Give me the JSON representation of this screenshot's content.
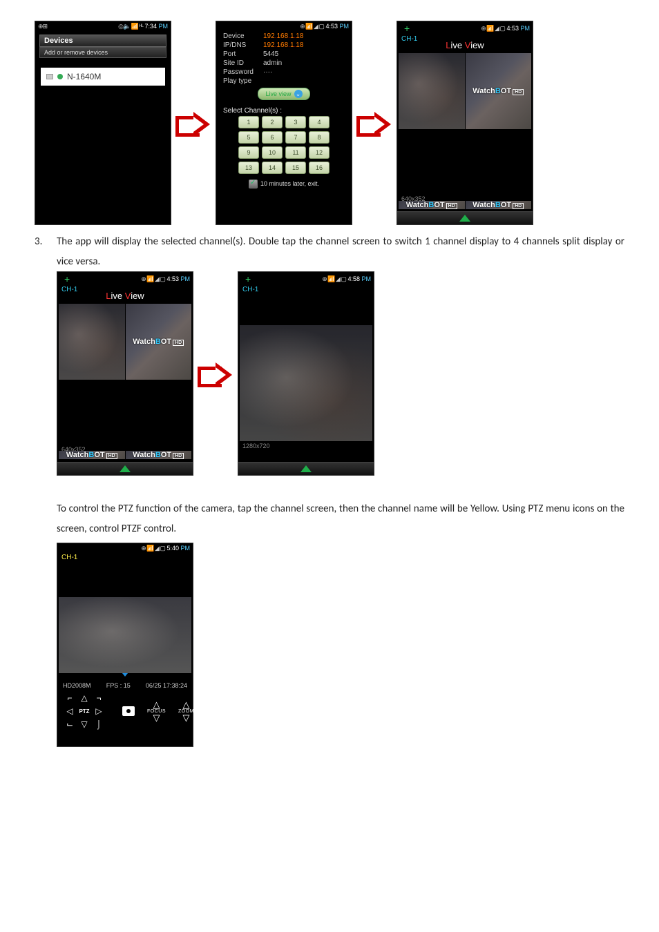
{
  "row1": {
    "phoneA": {
      "status_left": "⊕⊞",
      "status_right_icons": "◎🔈 📶 ᴴᴵᴸ",
      "status_time": "7:34",
      "status_pm": "PM",
      "devices_header": "Devices",
      "devices_sub": "Add or remove devices",
      "device_name": "N-1640M"
    },
    "phoneB": {
      "status_right_icons": "⊕ 📶 ◢ ▢",
      "status_time": "4:53",
      "status_pm": "PM",
      "fields": {
        "device_lbl": "Device",
        "device_val": "192.168.1.18",
        "ipdns_lbl": "IP/DNS",
        "ipdns_val": "192.168.1.18",
        "port_lbl": "Port",
        "port_val": "5445",
        "siteid_lbl": "Site ID",
        "siteid_val": "admin",
        "password_lbl": "Password",
        "password_val": "····",
        "playtype_lbl": "Play type",
        "liveview_btn": "Live view"
      },
      "select_label": "Select Channel(s) :",
      "channels": [
        "1",
        "2",
        "3",
        "4",
        "5",
        "6",
        "7",
        "8",
        "9",
        "10",
        "11",
        "12",
        "13",
        "14",
        "15",
        "16"
      ],
      "exit_text": "10 minutes later, exit."
    },
    "phoneC": {
      "status_right_icons": "⊕ 📶 ◢ ▢",
      "status_time": "4:53",
      "status_pm": "PM",
      "ch_label": "CH-1",
      "live_view": "Live View",
      "logo": "WatchBOT",
      "res": "640x352"
    }
  },
  "para3": {
    "num": "3.",
    "text": "The app will display the selected channel(s). Double tap the channel screen to switch 1 channel display to 4 channels split display or vice versa."
  },
  "row2": {
    "phoneA": {
      "status_right_icons": "⊕ 📶 ◢ ▢",
      "status_time": "4:53",
      "status_pm": "PM",
      "ch_label": "CH-1",
      "live_view": "Live View",
      "logo": "WatchBOT",
      "res": "640x352"
    },
    "phoneB": {
      "status_right_icons": "⊕ 📶 ◢ ▢",
      "status_time": "4:58",
      "status_pm": "PM",
      "ch_label": "CH-1",
      "res": "1280x720"
    }
  },
  "para_ptz": "To control the PTZ function of the camera, tap the channel screen, then the channel name will be Yellow. Using PTZ menu icons on the screen, control PTZF control.",
  "ptz": {
    "status_right_icons": "⊕ 📶 ◢ ▢",
    "status_time": "5:40",
    "status_pm": "PM",
    "ch_label": "CH-1",
    "model": "HD2008M",
    "fps": "FPS : 15",
    "timestamp": "06/25 17:38:24",
    "ptz_label": "PTZ",
    "focus_label": "FOCUS",
    "zoom_label": "ZOOM"
  }
}
